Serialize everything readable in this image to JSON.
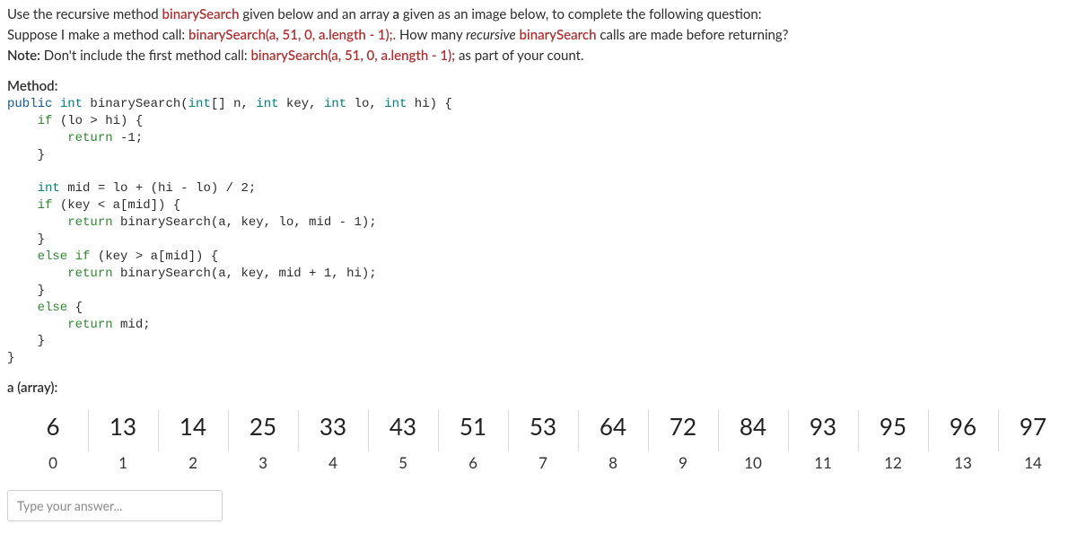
{
  "question": {
    "line1_a": "Use the recursive method ",
    "line1_b": "binarySearch",
    "line1_c": " given below and an array ",
    "line1_d": "a",
    "line1_e": " given as an image below, to complete the following question:",
    "line2_a": "Suppose I make a method call: ",
    "line2_b": "binarySearch(a, 51, 0, a.length - 1);",
    "line2_c": ". How many ",
    "line2_d": "recursive",
    "line2_e": " ",
    "line2_f": "binarySearch",
    "line2_g": " calls are made before returning?",
    "line3_a": "Note:",
    "line3_b": " Don't include the first method call: ",
    "line3_c": "binarySearch(a, 51, 0, a.length - 1);",
    "line3_d": " as part of your count."
  },
  "method_label": "Method:",
  "code": {
    "l1a": "public",
    "l1b": " int",
    "l1c": " binarySearch(",
    "l1d": "int",
    "l1e": "[] n, ",
    "l1f": "int",
    "l1g": " key, ",
    "l1h": "int",
    "l1i": " lo, ",
    "l1j": "int",
    "l1k": " hi) {",
    "l2a": "    if",
    "l2b": " (lo > hi) {",
    "l3a": "        return",
    "l3b": " -1;",
    "l4": "    }",
    "l5": "",
    "l6a": "    int",
    "l6b": " mid = lo + (hi - lo) / 2;",
    "l7a": "    if",
    "l7b": " (key < a[mid]) {",
    "l8a": "        return",
    "l8b": " binarySearch(a, key, lo, mid - 1);",
    "l9": "    }",
    "l10a": "    else if",
    "l10b": " (key > a[mid]) {",
    "l11a": "        return",
    "l11b": " binarySearch(a, key, mid + 1, hi);",
    "l12": "    }",
    "l13a": "    else",
    "l13b": " {",
    "l14a": "        return",
    "l14b": " mid;",
    "l15": "    }",
    "l16": "}"
  },
  "array_label": "a (array):",
  "array": {
    "values": [
      "6",
      "13",
      "14",
      "25",
      "33",
      "43",
      "51",
      "53",
      "64",
      "72",
      "84",
      "93",
      "95",
      "96",
      "97"
    ],
    "indices": [
      "0",
      "1",
      "2",
      "3",
      "4",
      "5",
      "6",
      "7",
      "8",
      "9",
      "10",
      "11",
      "12",
      "13",
      "14"
    ]
  },
  "answer_placeholder": "Type your answer..."
}
